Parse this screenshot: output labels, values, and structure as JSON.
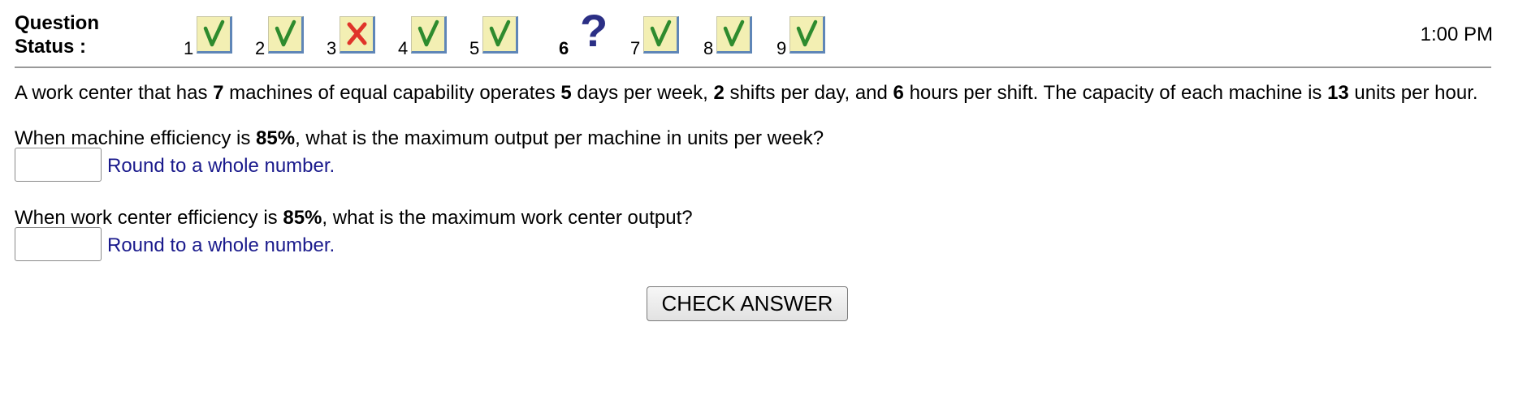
{
  "header": {
    "status_label_line1": "Question",
    "status_label_line2": "Status :",
    "time": "1:00 PM",
    "questions": [
      {
        "number": "1",
        "status": "correct",
        "icon": "check-icon"
      },
      {
        "number": "2",
        "status": "correct",
        "icon": "check-icon"
      },
      {
        "number": "3",
        "status": "incorrect",
        "icon": "x-icon"
      },
      {
        "number": "4",
        "status": "correct",
        "icon": "check-icon"
      },
      {
        "number": "5",
        "status": "correct",
        "icon": "check-icon"
      },
      {
        "number": "6",
        "status": "current",
        "icon": "question-mark-icon",
        "glyph": "?"
      },
      {
        "number": "7",
        "status": "correct",
        "icon": "check-icon"
      },
      {
        "number": "8",
        "status": "correct",
        "icon": "check-icon"
      },
      {
        "number": "9",
        "status": "correct",
        "icon": "check-icon"
      }
    ]
  },
  "question": {
    "intro": {
      "t1": "A work center that has ",
      "machines": "7",
      "t2": " machines of equal capability operates ",
      "days": "5",
      "t3": " days per week, ",
      "shifts": "2",
      "t4": " shifts per day, and ",
      "hours": "6",
      "t5": " hours per shift. The capacity of each machine is ",
      "capacity": "13",
      "t6": " units per hour."
    },
    "part_a": {
      "t1": "When machine efficiency is ",
      "efficiency": "85%",
      "t2": ", what is the maximum output per machine in units per week?",
      "answer_value": "",
      "hint": "Round to a whole number."
    },
    "part_b": {
      "t1": "When work center efficiency is ",
      "efficiency": "85%",
      "t2": ", what is the maximum work center output?",
      "answer_value": "",
      "hint": "Round to a whole number."
    }
  },
  "actions": {
    "check_answer_label": "CHECK ANSWER"
  },
  "colors": {
    "status_box_bg": "#f3efb3",
    "status_box_shadow": "#5f86b7",
    "check_green": "#2e8b2e",
    "x_red": "#e0342a",
    "question_mark": "#2b2f85",
    "hint_text": "#1a1a8c",
    "divider": "#999999"
  }
}
